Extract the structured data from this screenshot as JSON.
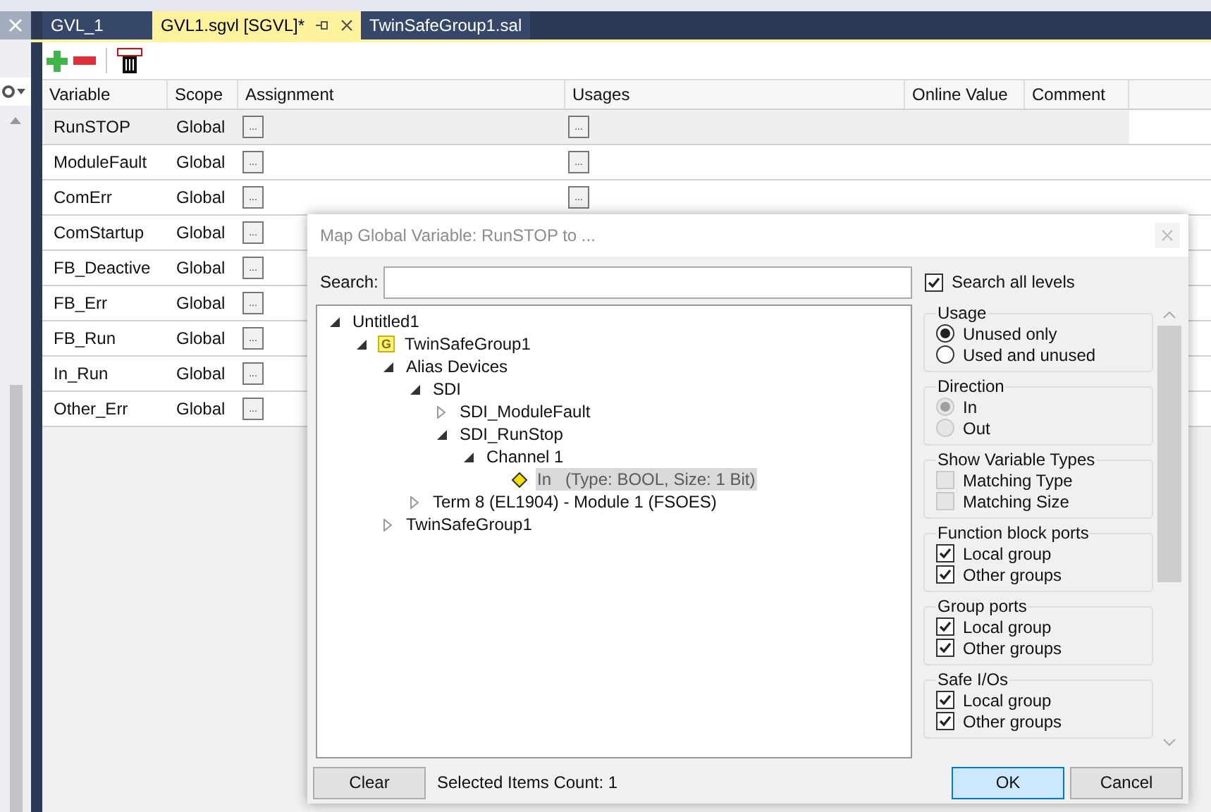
{
  "tabs": [
    {
      "label": "GVL_1",
      "selected": false
    },
    {
      "label": "GVL1.sgvl [SGVL]*",
      "selected": true
    },
    {
      "label": "TwinSafeGroup1.sal",
      "selected": false
    }
  ],
  "table": {
    "columns": [
      "Variable",
      "Scope",
      "Assignment",
      "Usages",
      "Online Value",
      "Comment"
    ],
    "rows": [
      {
        "variable": "RunSTOP",
        "scope": "Global",
        "assignment": "...",
        "usages": "...",
        "selected": true
      },
      {
        "variable": "ModuleFault",
        "scope": "Global",
        "assignment": "...",
        "usages": "...",
        "selected": false
      },
      {
        "variable": "ComErr",
        "scope": "Global",
        "assignment": "...",
        "usages": "...",
        "selected": false
      },
      {
        "variable": "ComStartup",
        "scope": "Global",
        "assignment": "...",
        "selected": false
      },
      {
        "variable": "FB_Deactive",
        "scope": "Global",
        "assignment": "...",
        "selected": false
      },
      {
        "variable": "FB_Err",
        "scope": "Global",
        "assignment": "...",
        "selected": false
      },
      {
        "variable": "FB_Run",
        "scope": "Global",
        "assignment": "...",
        "selected": false
      },
      {
        "variable": "In_Run",
        "scope": "Global",
        "assignment": "...",
        "selected": false
      },
      {
        "variable": "Other_Err",
        "scope": "Global",
        "assignment": "...",
        "selected": false
      }
    ]
  },
  "dialog": {
    "title": "Map Global Variable: RunSTOP to ...",
    "search_label": "Search:",
    "search_all_levels": {
      "label": "Search all levels",
      "checked": true
    },
    "tree": [
      {
        "label": "Untitled1",
        "expanded": true,
        "selected": false,
        "children": [
          {
            "kind": "group",
            "badge": "G",
            "label": "TwinSafeGroup1",
            "expanded": true,
            "selected": false,
            "children": [
              {
                "label": "Alias Devices",
                "expanded": true,
                "selected": false,
                "children": [
                  {
                    "label": "SDI",
                    "expanded": true,
                    "selected": false,
                    "children": [
                      {
                        "label": "SDI_ModuleFault",
                        "expanded": false,
                        "selected": false
                      },
                      {
                        "label": "SDI_RunStop",
                        "expanded": true,
                        "selected": false,
                        "children": [
                          {
                            "label": "Channel 1",
                            "expanded": true,
                            "selected": false,
                            "children": [
                              {
                                "kind": "variable",
                                "label": "In   (Type: BOOL, Size: 1 Bit)",
                                "selected": true
                              }
                            ]
                          }
                        ]
                      }
                    ]
                  },
                  {
                    "label": "Term 8 (EL1904) - Module 1 (FSOES)",
                    "expanded": false,
                    "selected": false
                  }
                ]
              },
              {
                "label": "TwinSafeGroup1",
                "expanded": false,
                "selected": false
              }
            ]
          }
        ]
      }
    ],
    "filters": [
      {
        "title": "Usage",
        "disabled": false,
        "options": [
          {
            "kind": "radio",
            "label": "Unused only",
            "selected": true
          },
          {
            "kind": "radio",
            "label": "Used and unused",
            "selected": false
          }
        ]
      },
      {
        "title": "Direction",
        "disabled": true,
        "options": [
          {
            "kind": "radio",
            "label": "In",
            "selected": true
          },
          {
            "kind": "radio",
            "label": "Out",
            "selected": false
          }
        ]
      },
      {
        "title": "Show Variable Types",
        "disabled": true,
        "options": [
          {
            "kind": "checkbox",
            "label": "Matching Type",
            "checked": false
          },
          {
            "kind": "checkbox",
            "label": "Matching Size",
            "checked": false
          }
        ]
      },
      {
        "title": "Function block ports",
        "disabled": false,
        "options": [
          {
            "kind": "checkbox",
            "label": "Local group",
            "checked": true
          },
          {
            "kind": "checkbox",
            "label": "Other groups",
            "checked": true
          }
        ]
      },
      {
        "title": "Group ports",
        "disabled": false,
        "options": [
          {
            "kind": "checkbox",
            "label": "Local group",
            "checked": true
          },
          {
            "kind": "checkbox",
            "label": "Other groups",
            "checked": true
          }
        ]
      },
      {
        "title": "Safe I/Os",
        "disabled": false,
        "options": [
          {
            "kind": "checkbox",
            "label": "Local group",
            "checked": true
          },
          {
            "kind": "checkbox",
            "label": "Other groups",
            "checked": true
          }
        ]
      }
    ],
    "status": "Selected Items Count: 1",
    "buttons": {
      "clear": "Clear",
      "ok": "OK",
      "cancel": "Cancel"
    }
  }
}
